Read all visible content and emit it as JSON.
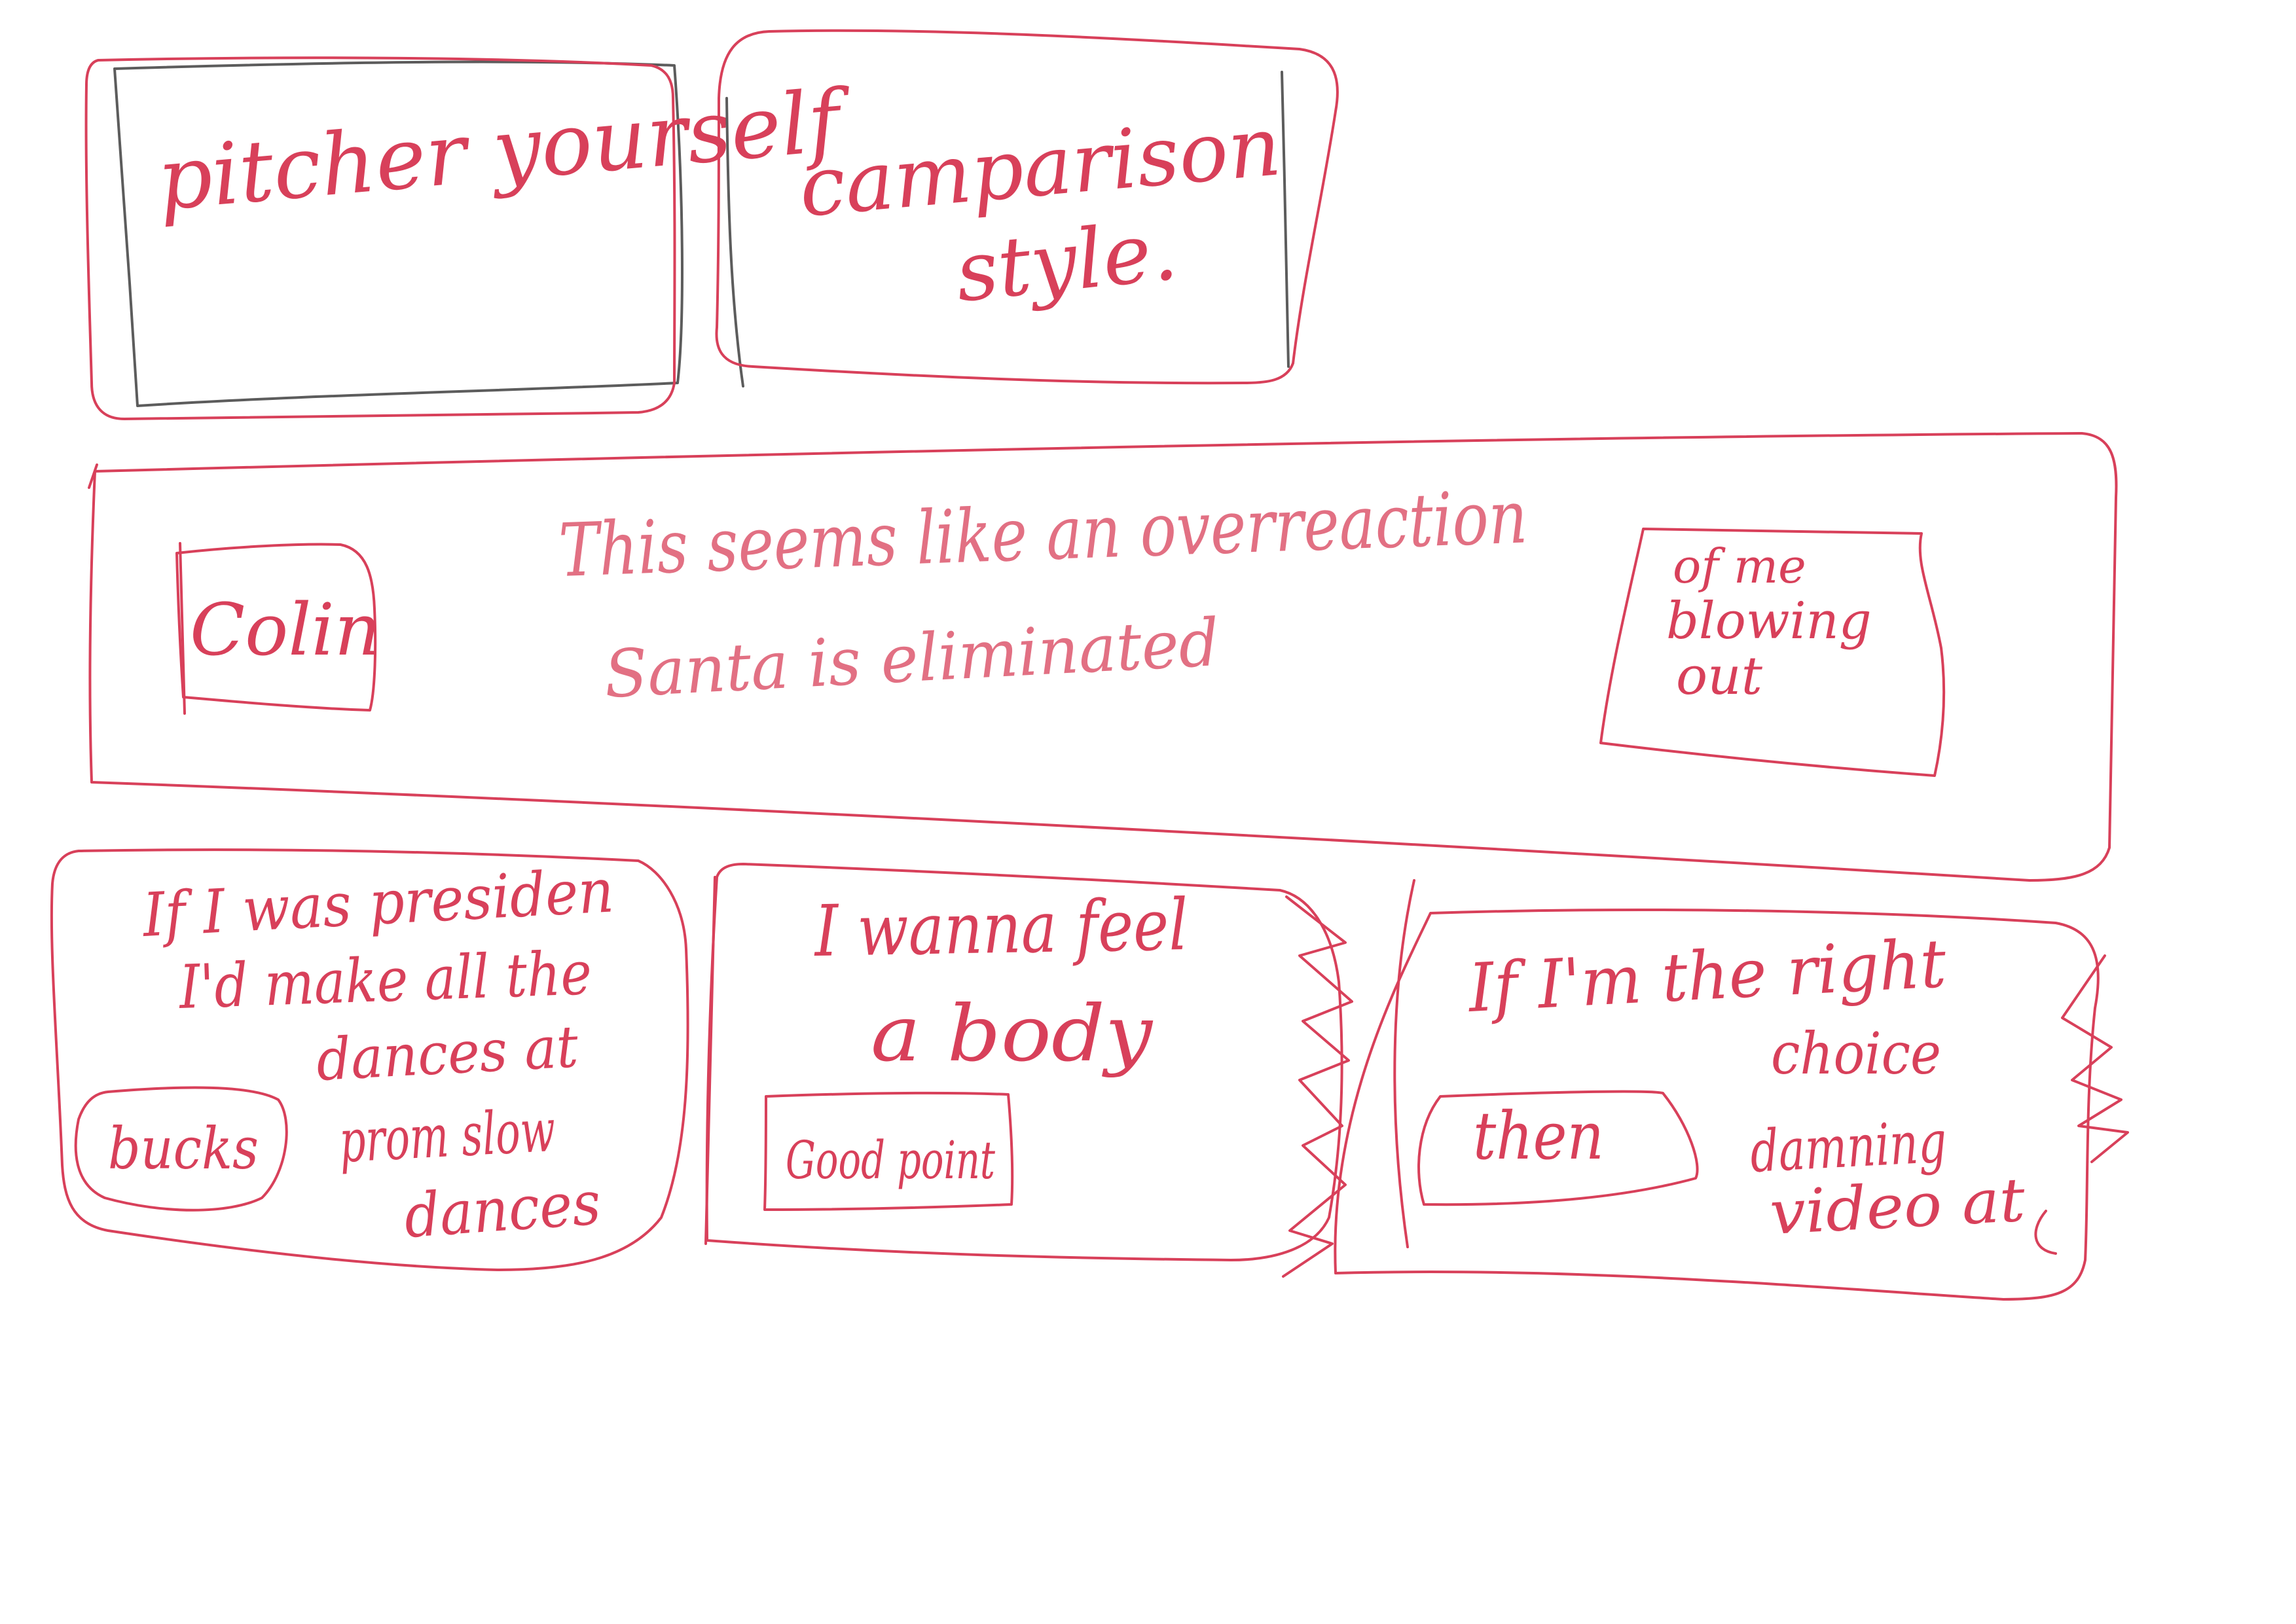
{
  "sheet": {
    "ink_color": "#d8405a",
    "pencil_color": "#5c5c5c",
    "background": "#ffffff"
  },
  "panels": {
    "p1": {
      "lines": [
        "pitcher yourself"
      ]
    },
    "p2": {
      "lines": [
        "camparison",
        "style."
      ]
    },
    "p3": {
      "lines": [
        "This seems like an overreaction",
        "Santa is eliminated"
      ],
      "left_box": "Colin",
      "right_box_lines": [
        "of me",
        "blowing",
        "out"
      ]
    },
    "p4": {
      "lines": [
        "If I was presiden",
        "I'd make all the",
        "dances at",
        "prom slow",
        "dances"
      ],
      "box": "bucks"
    },
    "p5": {
      "lines": [
        "I wanna feel",
        "a body"
      ],
      "box": "Good point"
    },
    "p6": {
      "lines": [
        "If I'm the right",
        "choice",
        "damning",
        "video at"
      ],
      "box": "then"
    }
  }
}
